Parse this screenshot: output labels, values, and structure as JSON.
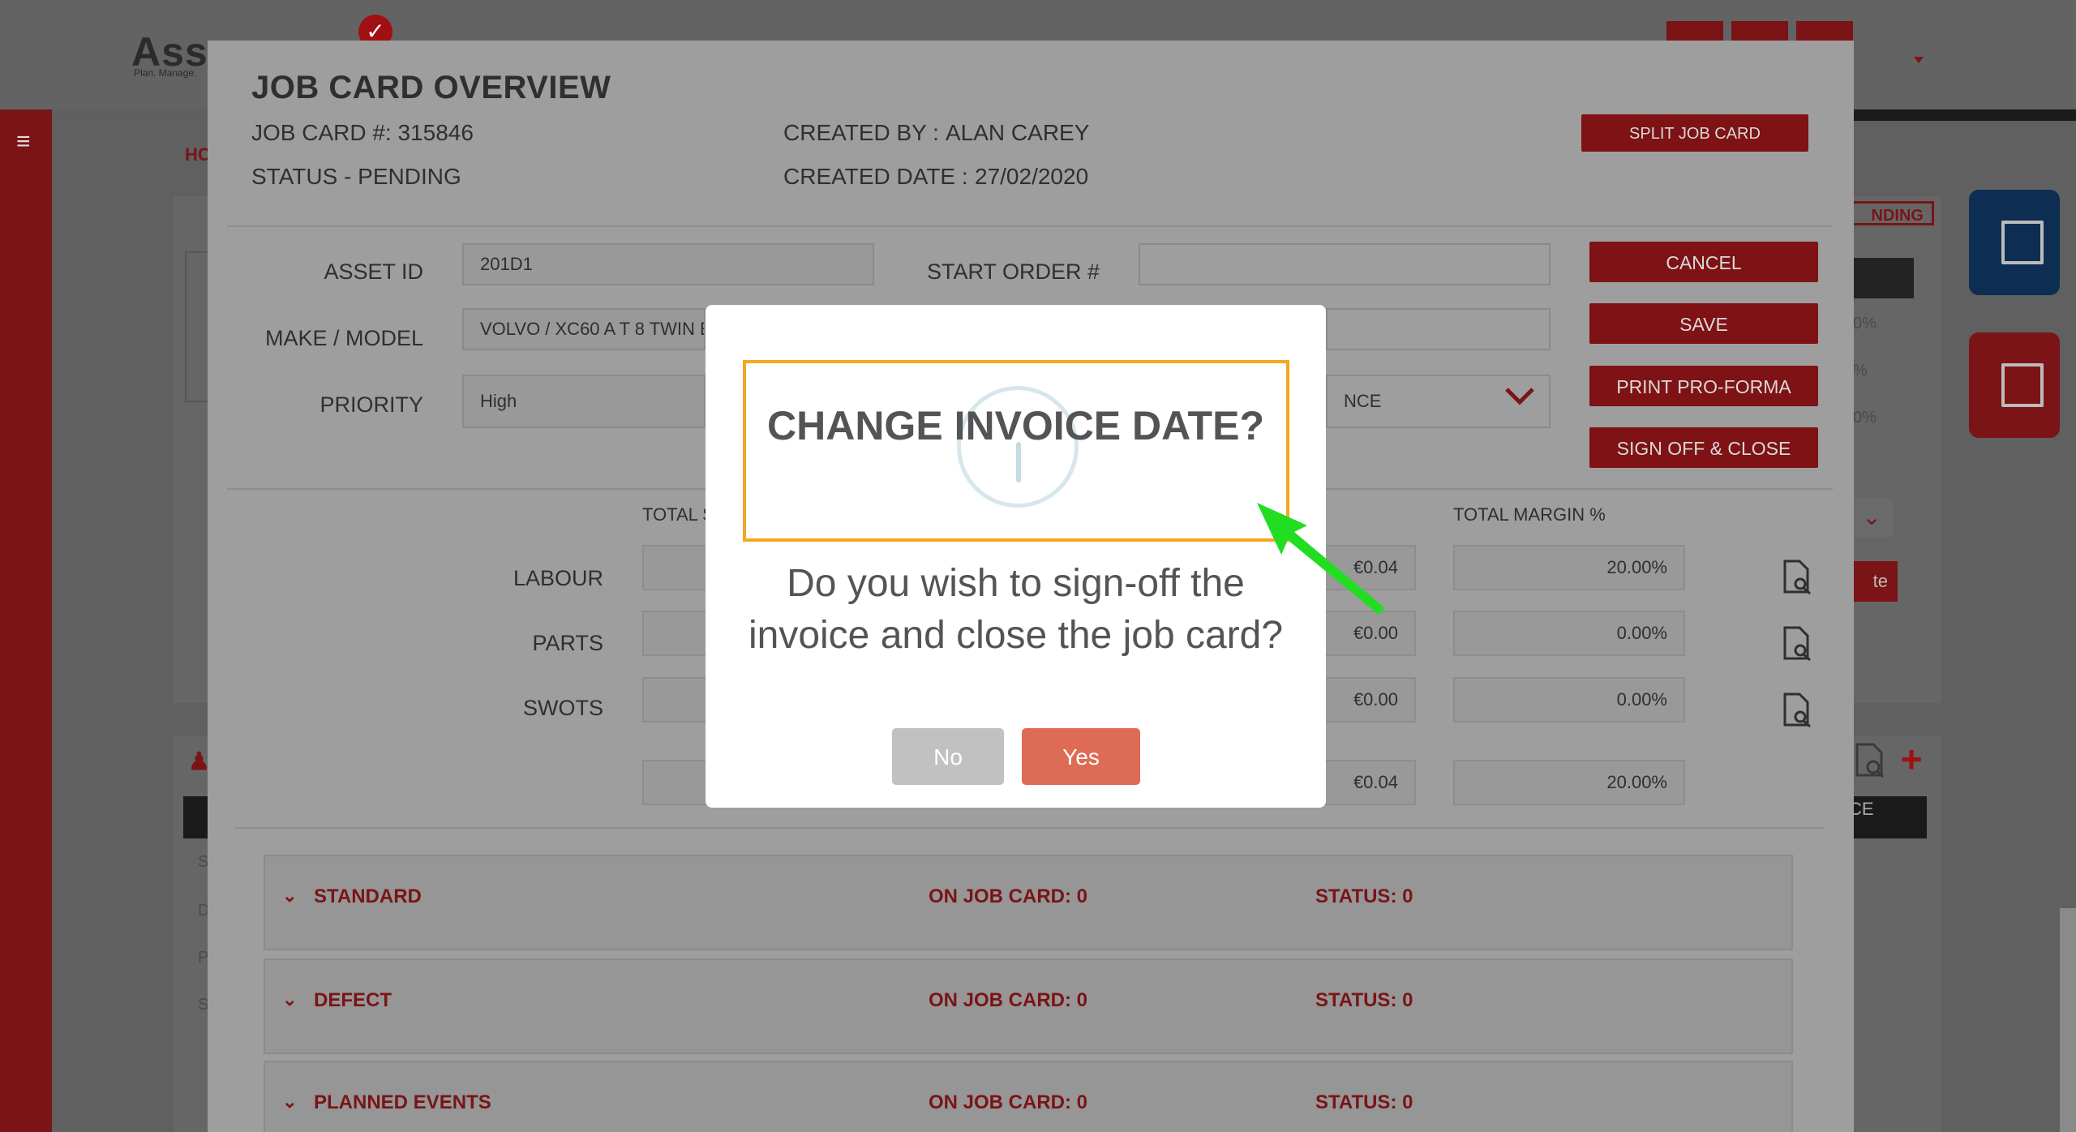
{
  "app": {
    "logo_text": "Asse",
    "logo_tagline": "Plan. Manage.",
    "breadcrumb_partial": "HC",
    "status_badge_partial": "NDING",
    "ghost_percentages": [
      "0%",
      "%",
      "0%"
    ],
    "ghost_button_partial": "te",
    "ghost_column_partial": "CE",
    "ghost_rows": [
      "S",
      "D",
      "P",
      "S"
    ]
  },
  "job_card": {
    "title": "JOB CARD OVERVIEW",
    "job_card_number": "JOB CARD #: 315846",
    "status": "STATUS - PENDING",
    "created_by_label": "CREATED BY :",
    "created_by_value": "ALAN CAREY",
    "created_date_label": "CREATED DATE :",
    "created_date_value": "27/02/2020",
    "split_button": "SPLIT JOB CARD",
    "form": {
      "asset_id_label": "ASSET ID",
      "asset_id_value": "201D1",
      "make_model_label": "MAKE / MODEL",
      "make_model_value": "VOLVO / XC60 A T 8 TWIN EN",
      "priority_label": "PRIORITY",
      "priority_value": "High",
      "start_order_label": "START ORDER #",
      "start_order_value": "",
      "second_field_value": "",
      "select_partial": "NCE"
    },
    "actions": {
      "cancel": "CANCEL",
      "save": "SAVE",
      "print": "PRINT PRO-FORMA",
      "sign_off": "SIGN OFF & CLOSE"
    },
    "summary": {
      "total_col_partial": "TOTAL S",
      "total_margin_header": "TOTAL MARGIN %",
      "rows": [
        {
          "label": "LABOUR",
          "value": "€0.04",
          "margin": "20.00%"
        },
        {
          "label": "PARTS",
          "value": "€0.00",
          "margin": "0.00%"
        },
        {
          "label": "SWOTS",
          "value": "€0.00",
          "margin": "0.00%"
        }
      ],
      "total_value": "€0.04",
      "total_margin": "20.00%"
    },
    "sections": [
      {
        "name": "STANDARD",
        "on_job_card": "ON JOB CARD: 0",
        "status": "STATUS: 0"
      },
      {
        "name": "DEFECT",
        "on_job_card": "ON JOB CARD: 0",
        "status": "STATUS: 0"
      },
      {
        "name": "PLANNED EVENTS",
        "on_job_card": "ON JOB CARD: 0",
        "status": "STATUS: 0"
      }
    ]
  },
  "dialog": {
    "title": "CHANGE INVOICE DATE?",
    "message_line1": "Do you wish to sign-off the",
    "message_line2": "invoice and close the job card?",
    "no_label": "No",
    "yes_label": "Yes"
  },
  "colors": {
    "brand_red": "#a00f12",
    "yes_button": "#dd6b55",
    "no_button": "#c1c1c1",
    "highlight": "#f5a623",
    "pointer_arrow": "#22dd22"
  },
  "icons": [
    "menu-icon",
    "checkmark-icon",
    "chevron-down-icon",
    "document-search-icon",
    "plus-icon",
    "edit-icon",
    "info-icon",
    "arrow-pointer-icon"
  ]
}
